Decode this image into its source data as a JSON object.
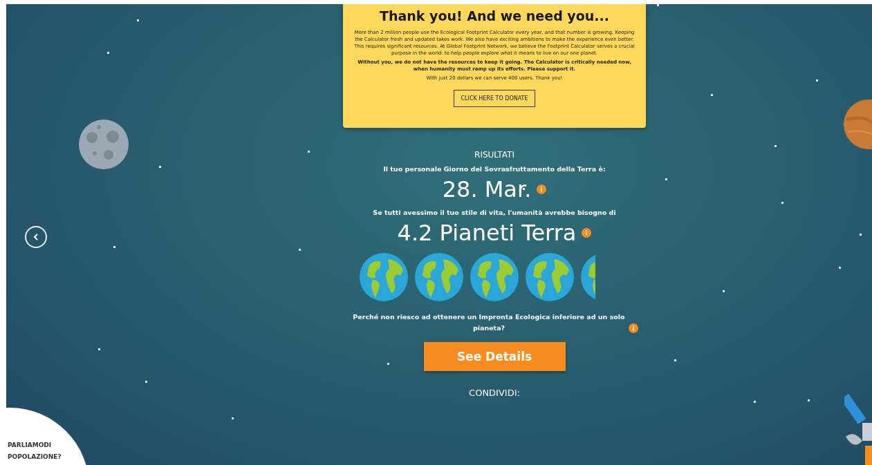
{
  "donation_card": {
    "title": "Thank you! And we need you...",
    "paragraphs": [
      {
        "text": "More than 2 million people use the Ecological Footprint Calculator every year, and that number is growing. Keeping the Calculator fresh and updated takes work. We also have exciting ambitions to make the experience even better. This requires significant resources. At Global Footprint Network, we believe the Footprint Calculator serves a crucial purpose in the world: to help people explore what it means to live on our one planet.",
        "bold": false
      },
      {
        "text": "Without you, we do not have the resources to keep it going. The Calculator is critically needed now, when humanity must ramp up its efforts. Please support it.",
        "bold": true
      },
      {
        "text": "With just 20 dollars we can serve 400 users. Thank you!",
        "bold": false
      }
    ],
    "button": "CLICK HERE TO DONATE"
  },
  "results": {
    "heading": "RISULTATI",
    "overshoot_label": "Il tuo personale Giorno del Sovrasfruttamento della Terra è:",
    "overshoot_day": "28. Mar.",
    "planets_label": "Se tutti avessimo il tuo stile di vita, l'umanità avrebbe bisogno di",
    "planets_value": "4.2 Pianeti Terra",
    "question": "Perché non riesco ad ottenere un Impronta Ecologica inferiore ad un solo pianeta?",
    "details_button": "See Details",
    "share_label": "CONDIVIDI:"
  },
  "corner_link": {
    "lines": [
      "PARLIAMODI",
      "POPOLAZIONE?"
    ]
  }
}
